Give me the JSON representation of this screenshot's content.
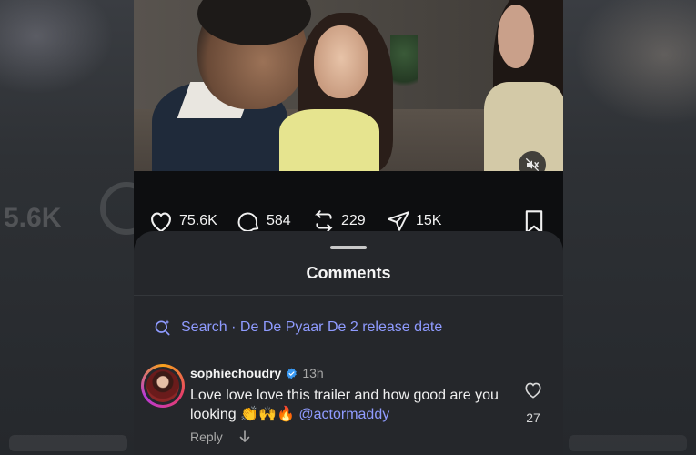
{
  "post": {
    "likes": "75.6K",
    "comments": "584",
    "reposts": "229",
    "shares": "15K"
  },
  "sheet": {
    "title": "Comments",
    "search_text": "Search · De De Pyaar De 2 release date"
  },
  "comment": {
    "username": "sophiechoudry",
    "time": "13h",
    "text": "Love love love this trailer and how good are you looking 👏🙌🔥",
    "mention": "@actormaddy",
    "reply_label": "Reply",
    "like_count": "27"
  },
  "background": {
    "ghost_text": "5.6K"
  },
  "colors": {
    "accent_link": "#8f9bff",
    "sheet_bg": "#25272b",
    "verified": "#3897f0"
  }
}
